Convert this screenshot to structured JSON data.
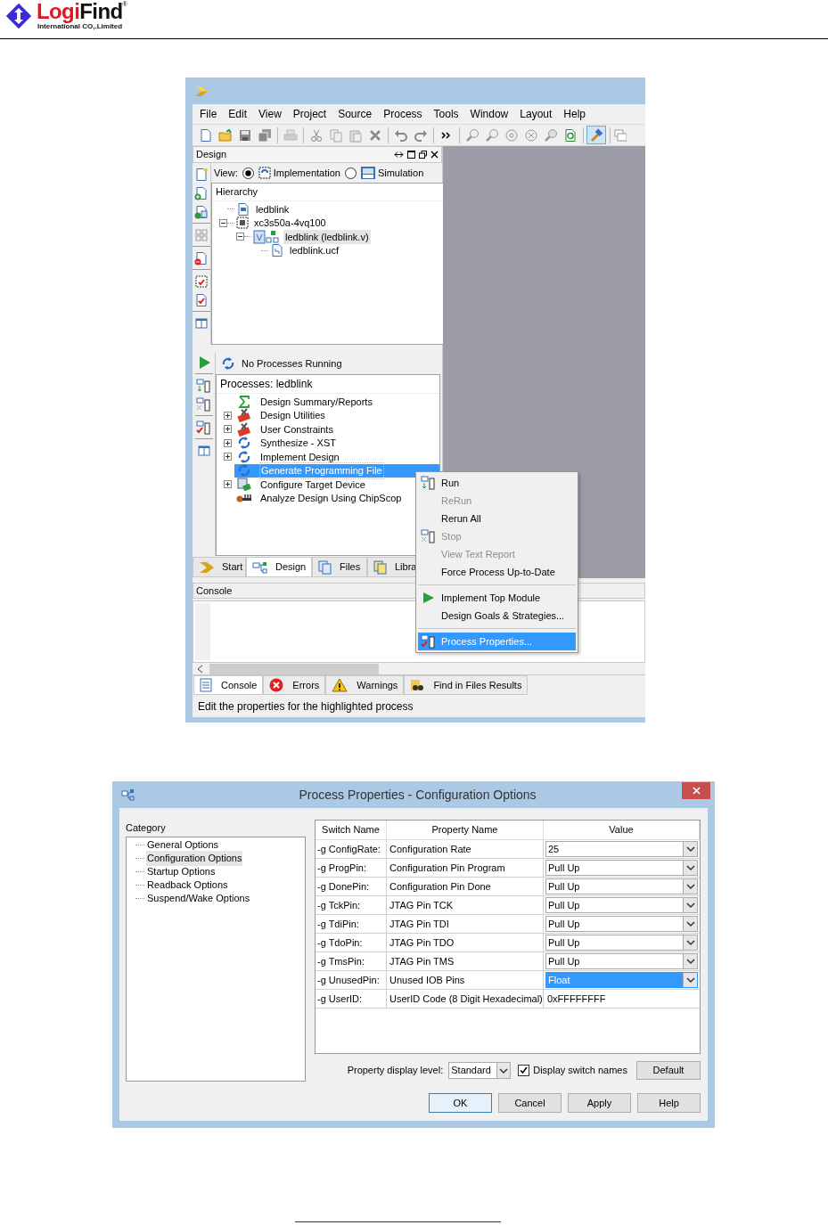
{
  "header": {
    "brand_first": "Logi",
    "brand_second": "Find",
    "trademark": "®",
    "company": "International CO,.Limited"
  },
  "ise": {
    "menus": [
      "File",
      "Edit",
      "View",
      "Project",
      "Source",
      "Process",
      "Tools",
      "Window",
      "Layout",
      "Help"
    ],
    "design_panel": {
      "title": "Design",
      "view_label": "View:",
      "view_options": [
        {
          "label": "Implementation",
          "selected": true
        },
        {
          "label": "Simulation",
          "selected": false
        }
      ],
      "hierarchy_title": "Hierarchy",
      "tree": [
        {
          "label": "ledblink",
          "kind": "project",
          "selected": false
        },
        {
          "label": "xc3s50a-4vq100",
          "kind": "device",
          "selected": false,
          "expanded": true,
          "children": [
            {
              "label": "ledblink (ledblink.v)",
              "kind": "module",
              "selected": true,
              "expanded": true,
              "children": [
                {
                  "label": "ledblink.ucf",
                  "kind": "constraints",
                  "selected": false
                }
              ]
            }
          ]
        }
      ],
      "process_status": "No Processes Running",
      "processes_title": "Processes: ledblink",
      "processes": [
        {
          "label": "Design Summary/Reports",
          "kind": "report",
          "selected": false
        },
        {
          "label": "Design Utilities",
          "kind": "tools",
          "selected": false,
          "expanded": false
        },
        {
          "label": "User Constraints",
          "kind": "tools",
          "selected": false,
          "expanded": false
        },
        {
          "label": "Synthesize - XST",
          "kind": "process",
          "selected": false,
          "expanded": false
        },
        {
          "label": "Implement Design",
          "kind": "process",
          "selected": false,
          "expanded": false
        },
        {
          "label": "Generate Programming File",
          "kind": "process",
          "selected": true
        },
        {
          "label": "Configure Target Device",
          "kind": "configure",
          "selected": false,
          "expanded": false
        },
        {
          "label": "Analyze Design Using ChipScop",
          "kind": "analyze",
          "selected": false
        }
      ],
      "tabs": [
        {
          "label": "Start",
          "kind": "start",
          "selected": false
        },
        {
          "label": "Design",
          "kind": "design",
          "selected": true
        },
        {
          "label": "Files",
          "kind": "files",
          "selected": false
        },
        {
          "label": "Libra",
          "kind": "libraries",
          "selected": false
        }
      ]
    },
    "console_title": "Console",
    "console_tabs": [
      {
        "label": "Console",
        "kind": "console",
        "selected": true
      },
      {
        "label": "Errors",
        "kind": "errors",
        "selected": false
      },
      {
        "label": "Warnings",
        "kind": "warnings",
        "selected": false
      },
      {
        "label": "Find in Files Results",
        "kind": "find",
        "selected": false
      }
    ],
    "status_bar": "Edit the properties for the highlighted process",
    "context_menu": [
      {
        "label": "Run",
        "kind": "run",
        "disabled": false,
        "selected": false
      },
      {
        "label": "ReRun",
        "kind": "plain",
        "disabled": true,
        "selected": false
      },
      {
        "label": "Rerun All",
        "kind": "plain",
        "disabled": false,
        "selected": false
      },
      {
        "label": "Stop",
        "kind": "stop",
        "disabled": true,
        "selected": false
      },
      {
        "label": "View Text Report",
        "kind": "plain",
        "disabled": true,
        "selected": false
      },
      {
        "label": "Force Process Up-to-Date",
        "kind": "plain",
        "disabled": false,
        "selected": false
      },
      {
        "kind": "separator"
      },
      {
        "label": "Implement Top Module",
        "kind": "play",
        "disabled": false,
        "selected": false
      },
      {
        "label": "Design Goals & Strategies...",
        "kind": "plain",
        "disabled": false,
        "selected": false
      },
      {
        "kind": "separator"
      },
      {
        "label": "Process Properties...",
        "kind": "properties",
        "disabled": false,
        "selected": true
      }
    ]
  },
  "dialog": {
    "title": "Process Properties - Configuration Options",
    "category_label": "Category",
    "categories": [
      {
        "label": "General Options",
        "selected": false
      },
      {
        "label": "Configuration Options",
        "selected": true
      },
      {
        "label": "Startup Options",
        "selected": false
      },
      {
        "label": "Readback Options",
        "selected": false
      },
      {
        "label": "Suspend/Wake Options",
        "selected": false
      }
    ],
    "columns": [
      "Switch Name",
      "Property Name",
      "Value"
    ],
    "rows": [
      {
        "switch": "-g ConfigRate:",
        "property": "Configuration Rate",
        "value": "25",
        "kind": "dropdown",
        "selected": false
      },
      {
        "switch": "-g ProgPin:",
        "property": "Configuration Pin Program",
        "value": "Pull Up",
        "kind": "dropdown",
        "selected": false
      },
      {
        "switch": "-g DonePin:",
        "property": "Configuration Pin Done",
        "value": "Pull Up",
        "kind": "dropdown",
        "selected": false
      },
      {
        "switch": "-g TckPin:",
        "property": "JTAG Pin TCK",
        "value": "Pull Up",
        "kind": "dropdown",
        "selected": false
      },
      {
        "switch": "-g TdiPin:",
        "property": "JTAG Pin TDI",
        "value": "Pull Up",
        "kind": "dropdown",
        "selected": false
      },
      {
        "switch": "-g TdoPin:",
        "property": "JTAG Pin TDO",
        "value": "Pull Up",
        "kind": "dropdown",
        "selected": false
      },
      {
        "switch": "-g TmsPin:",
        "property": "JTAG Pin TMS",
        "value": "Pull Up",
        "kind": "dropdown",
        "selected": false
      },
      {
        "switch": "-g UnusedPin:",
        "property": "Unused IOB Pins",
        "value": "Float",
        "kind": "dropdown",
        "selected": true
      },
      {
        "switch": "-g UserID:",
        "property": "UserID Code (8 Digit Hexadecimal)",
        "value": "0xFFFFFFFF",
        "kind": "text",
        "selected": false
      }
    ],
    "display_level_label": "Property display level:",
    "display_level": "Standard",
    "switch_names": {
      "label": "Display switch names",
      "checked": true
    },
    "default_button": "Default",
    "buttons": [
      {
        "label": "OK",
        "focused": true
      },
      {
        "label": "Cancel",
        "focused": false
      },
      {
        "label": "Apply",
        "focused": false
      },
      {
        "label": "Help",
        "focused": false
      }
    ]
  }
}
